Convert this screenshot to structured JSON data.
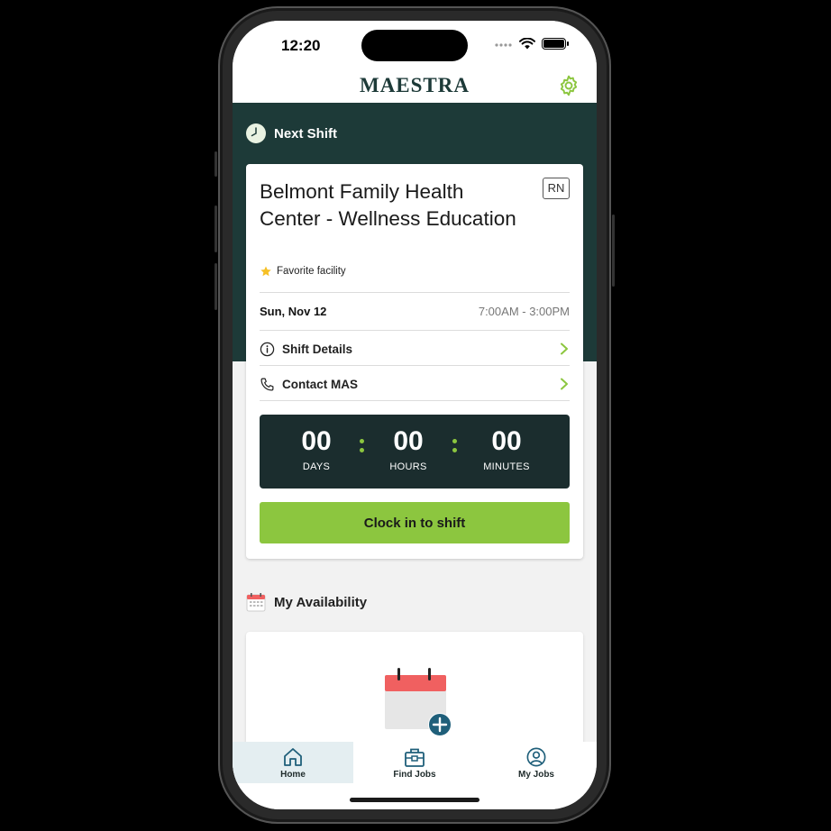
{
  "status_bar": {
    "time": "12:20"
  },
  "header": {
    "brand": "MAESTRA"
  },
  "next_shift": {
    "heading": "Next Shift",
    "facility": "Belmont Family Health Center - Wellness Education",
    "role_badge": "RN",
    "favorite_label": "Favorite facility",
    "date": "Sun, Nov 12",
    "time_range": "7:00AM - 3:00PM",
    "links": [
      {
        "label": "Shift Details",
        "icon": "info-icon"
      },
      {
        "label": "Contact MAS",
        "icon": "phone-icon"
      }
    ],
    "countdown": {
      "days": "00",
      "days_label": "DAYS",
      "hours": "00",
      "hours_label": "HOURS",
      "minutes": "00",
      "minutes_label": "MINUTES"
    },
    "clock_in_label": "Clock in to shift"
  },
  "availability": {
    "heading": "My Availability"
  },
  "nav": {
    "items": [
      {
        "label": "Home",
        "icon": "home-icon",
        "active": true
      },
      {
        "label": "Find Jobs",
        "icon": "briefcase-icon",
        "active": false
      },
      {
        "label": "My Jobs",
        "icon": "user-circle-icon",
        "active": false
      }
    ]
  },
  "colors": {
    "brand_dark": "#1d3a38",
    "accent_green": "#8cc63f",
    "countdown_bg": "#1b2d2e",
    "nav_icon": "#1f5f7a"
  }
}
